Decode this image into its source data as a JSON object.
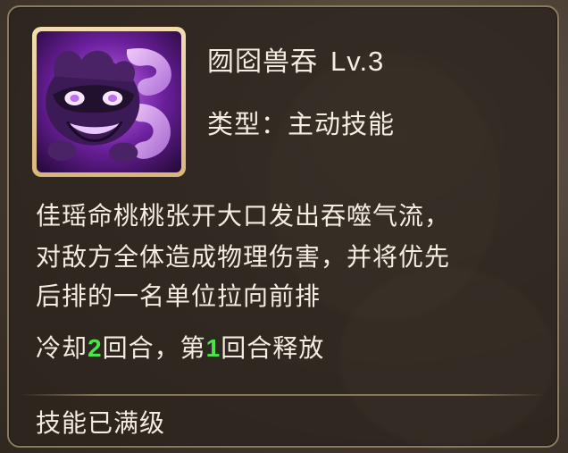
{
  "skill": {
    "name": "囫囵兽吞",
    "level": "Lv.3",
    "type_label": "类型：主动技能",
    "icon": "purple-beast-mask-icon"
  },
  "description": {
    "line1": "佳瑶命桃桃张开大口发出吞噬气流，",
    "line2": "对敌方全体造成物理伤害，并将优先",
    "line3": "后排的一名单位拉向前排"
  },
  "cooldown": {
    "prefix": "冷却",
    "turns": "2",
    "middle": "回合，第",
    "release_turn": "1",
    "suffix": "回合释放"
  },
  "status": {
    "max_level": "技能已满级"
  },
  "colors": {
    "highlight": "#4de34a",
    "text": "#f4ede1",
    "frame": "#e8c98d"
  }
}
